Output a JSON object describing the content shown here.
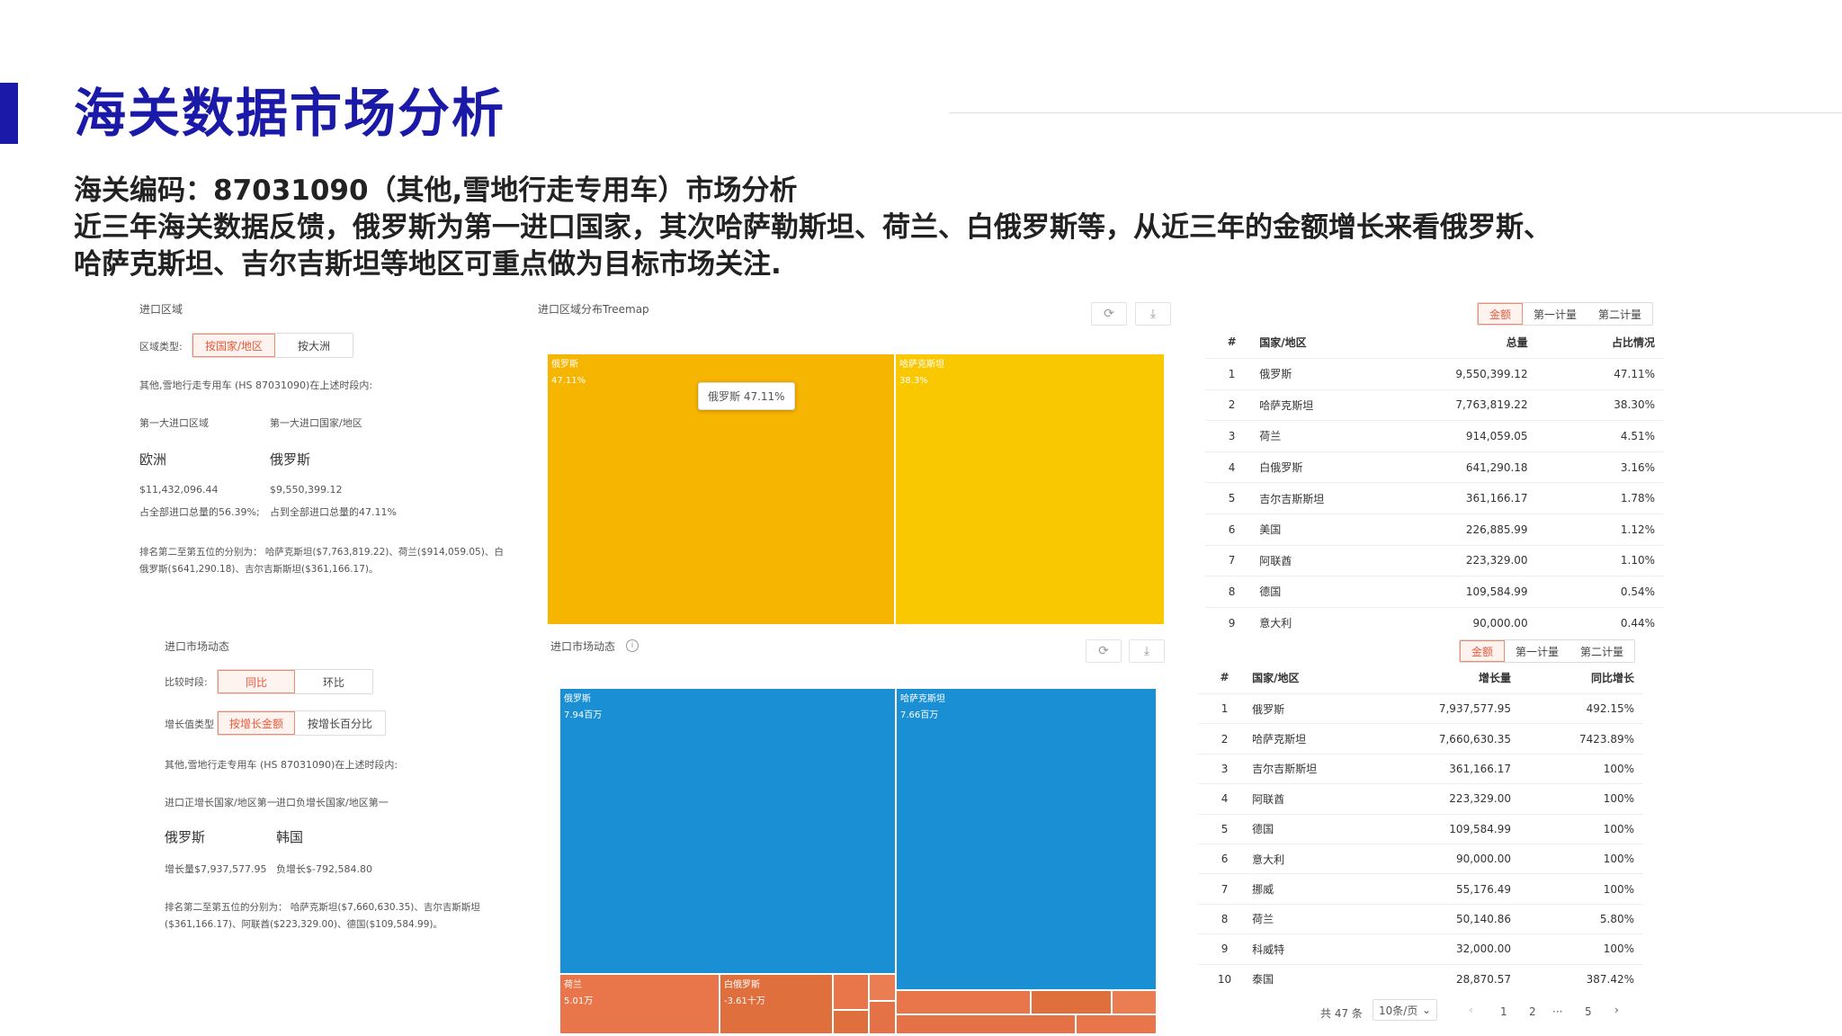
{
  "header": {
    "title": "海关数据市场分析",
    "subtitle": "海关编码：87031090（其他,雪地行走专用车）市场分析",
    "desc_line1": "近三年海关数据反馈，俄罗斯为第一进口国家，其次哈萨勒斯坦、荷兰、白俄罗斯等，从近三年的金额增长来看俄罗斯、",
    "desc_line2": "哈萨克斯坦、吉尔吉斯坦等地区可重点做为目标市场关注."
  },
  "left_top": {
    "section_title": "进口区域",
    "type_label": "区域类型:",
    "seg": [
      "按国家/地区",
      "按大洲"
    ],
    "scope_text": "其他,雪地行走专用车 (HS 87031090)在上述时段内:",
    "col1_label": "第一大进口区域",
    "col2_label": "第一大进口国家/地区",
    "col1_value": "欧洲",
    "col2_value": "俄罗斯",
    "col1_amount": "$11,432,096.44",
    "col2_amount": "$9,550,399.12",
    "col1_share": "占全部进口总量的56.39%;",
    "col2_share": "占到全部进口总量的47.11%",
    "note_line1": "排名第二至第五位的分别为：  哈萨克斯坦($7,763,819.22)、荷兰($914,059.05)、白",
    "note_line2": "俄罗斯($641,290.18)、吉尔吉斯斯坦($361,166.17)。"
  },
  "left_bottom": {
    "section_title": "进口市场动态",
    "compare_label": "比较时段:",
    "seg1": [
      "同比",
      "环比"
    ],
    "growth_label": "增长值类型",
    "seg2": [
      "按增长金额",
      "按增长百分比"
    ],
    "scope_text": "其他,雪地行走专用车 (HS 87031090)在上述时段内:",
    "col1_label": "进口正增长国家/地区第一",
    "col2_label": "进口负增长国家/地区第一",
    "col1_value": "俄罗斯",
    "col2_value": "韩国",
    "col1_amount": "增长量$7,937,577.95",
    "col2_amount": "负增长$-792,584.80",
    "note_line1": "排名第二至第五位的分别为：  哈萨克斯坦($7,660,630.35)、吉尔吉斯斯坦",
    "note_line2": "($361,166.17)、阿联酋($223,329.00)、德国($109,584.99)。"
  },
  "treemap_top": {
    "title": "进口区域分布Treemap",
    "refresh_icon": "refresh-icon",
    "download_icon": "download-icon",
    "tooltip": "俄罗斯 47.11%",
    "cells": [
      {
        "name": "俄罗斯",
        "value": "47.11%",
        "color": "#f6b500"
      },
      {
        "name": "哈萨克斯坦",
        "value": "38.3%",
        "color": "#f9c800"
      }
    ]
  },
  "treemap_bottom": {
    "title": "进口市场动态",
    "info_icon": "info-icon",
    "refresh_icon": "refresh-icon",
    "download_icon": "download-icon",
    "cells": [
      {
        "name": "俄罗斯",
        "value": "7.94百万",
        "color": "#1b8fd3"
      },
      {
        "name": "哈萨克斯坦",
        "value": "7.66百万",
        "color": "#1b8fd3"
      },
      {
        "name": "荷兰",
        "value": "5.01万",
        "color": "#e8764a"
      },
      {
        "name": "白俄罗斯",
        "value": "-3.61十万",
        "color": "#e06f3e"
      }
    ]
  },
  "table_top": {
    "tabs": [
      "金额",
      "第一计量",
      "第二计量"
    ],
    "headers": [
      "#",
      "国家/地区",
      "总量",
      "占比情况"
    ],
    "rows": [
      [
        "1",
        "俄罗斯",
        "9,550,399.12",
        "47.11%"
      ],
      [
        "2",
        "哈萨克斯坦",
        "7,763,819.22",
        "38.30%"
      ],
      [
        "3",
        "荷兰",
        "914,059.05",
        "4.51%"
      ],
      [
        "4",
        "白俄罗斯",
        "641,290.18",
        "3.16%"
      ],
      [
        "5",
        "吉尔吉斯斯坦",
        "361,166.17",
        "1.78%"
      ],
      [
        "6",
        "美国",
        "226,885.99",
        "1.12%"
      ],
      [
        "7",
        "阿联酋",
        "223,329.00",
        "1.10%"
      ],
      [
        "8",
        "德国",
        "109,584.99",
        "0.54%"
      ],
      [
        "9",
        "意大利",
        "90,000.00",
        "0.44%"
      ]
    ]
  },
  "table_bottom": {
    "tabs": [
      "金额",
      "第一计量",
      "第二计量"
    ],
    "headers": [
      "#",
      "国家/地区",
      "增长量",
      "同比增长"
    ],
    "rows": [
      [
        "1",
        "俄罗斯",
        "7,937,577.95",
        "492.15%"
      ],
      [
        "2",
        "哈萨克斯坦",
        "7,660,630.35",
        "7423.89%"
      ],
      [
        "3",
        "吉尔吉斯斯坦",
        "361,166.17",
        "100%"
      ],
      [
        "4",
        "阿联酋",
        "223,329.00",
        "100%"
      ],
      [
        "5",
        "德国",
        "109,584.99",
        "100%"
      ],
      [
        "6",
        "意大利",
        "90,000.00",
        "100%"
      ],
      [
        "7",
        "挪威",
        "55,176.49",
        "100%"
      ],
      [
        "8",
        "荷兰",
        "50,140.86",
        "5.80%"
      ],
      [
        "9",
        "科威特",
        "32,000.00",
        "100%"
      ],
      [
        "10",
        "泰国",
        "28,870.57",
        "387.42%"
      ]
    ],
    "pager": {
      "total": "共 47 条",
      "page_size": "10条/页",
      "prev": "‹",
      "pages": [
        "1",
        "2",
        "···",
        "5"
      ],
      "next": "›"
    }
  }
}
